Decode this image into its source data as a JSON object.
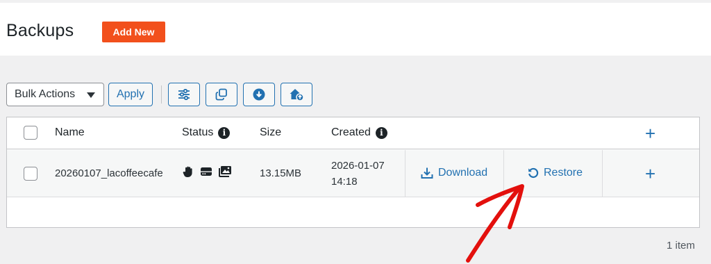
{
  "header": {
    "title": "Backups",
    "add_new_label": "Add New"
  },
  "toolbar": {
    "bulk_actions": "Bulk Actions",
    "apply_label": "Apply",
    "icons": [
      "sliders-icon",
      "copy-icon",
      "download-circle-icon",
      "home-upload-icon"
    ]
  },
  "table": {
    "columns": {
      "name": "Name",
      "status": "Status",
      "size": "Size",
      "created": "Created"
    },
    "rows": [
      {
        "name": "20260107_lacoffeecafe",
        "status_icons": [
          "hand-icon",
          "drive-icon",
          "images-icon"
        ],
        "size": "13.15MB",
        "created_date": "2026-01-07",
        "created_time": "14:18",
        "download_label": "Download",
        "restore_label": "Restore"
      }
    ]
  },
  "footer": {
    "items_count": "1 item"
  },
  "colors": {
    "accent": "#2271b1",
    "add_new": "#f2501c",
    "annotation_arrow": "#e3100d"
  }
}
